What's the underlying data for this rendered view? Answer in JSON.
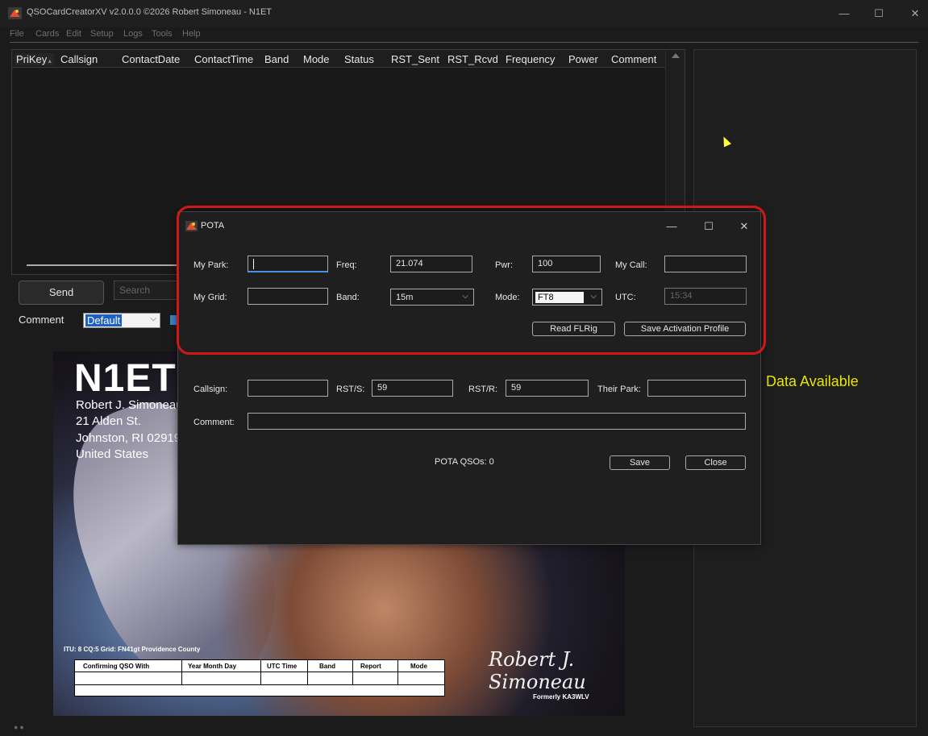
{
  "app": {
    "title": "QSOCardCreatorXV v2.0.0.0 ©2026 Robert Simoneau - N1ET",
    "icon": "app-logo-icon",
    "window_controls": {
      "minimize": "—",
      "maximize": "☐",
      "close": "✕"
    }
  },
  "menu": [
    "File",
    "Cards",
    "Edit",
    "Setup",
    "Logs",
    "Tools",
    "Help"
  ],
  "grid": {
    "columns": [
      "PriKey",
      "Callsign",
      "ContactDate",
      "ContactTime",
      "Band",
      "Mode",
      "Status",
      "RST_Sent",
      "RST_Rcvd",
      "Frequency",
      "Power",
      "Comment"
    ],
    "sorted_column": "PriKey",
    "sort_glyph": "▲"
  },
  "controls": {
    "send_label": "Send",
    "search_placeholder": "Search",
    "comment_label": "Comment",
    "comment_value": "Default"
  },
  "right_panel": {
    "message": "Data Available"
  },
  "card": {
    "callsign": "N1ET",
    "name": "Robert J. Simoneau",
    "street": "21 Alden St.",
    "city": "Johnston, RI 02919",
    "country": "United States",
    "location": "ITU: 8 CQ:5 Grid: FN41gt Providence County",
    "table_headers": [
      "Confirming QSO With",
      "Year Month Day",
      "UTC Time",
      "Band",
      "Report",
      "Mode"
    ],
    "signature": "Robert J. Simoneau",
    "formerly": "Formerly KA3WLV"
  },
  "pota": {
    "title": "POTA",
    "icon": "pota-logo-icon",
    "window_controls": {
      "minimize": "—",
      "maximize": "☐",
      "close": "✕"
    },
    "labels": {
      "my_park": "My Park:",
      "freq": "Freq:",
      "pwr": "Pwr:",
      "my_call": "My Call:",
      "my_grid": "My Grid:",
      "band": "Band:",
      "mode": "Mode:",
      "utc": "UTC:",
      "callsign": "Callsign:",
      "rst_s": "RST/S:",
      "rst_r": "RST/R:",
      "their_park": "Their Park:",
      "comment": "Comment:"
    },
    "values": {
      "my_park": "",
      "freq": "21.074",
      "pwr": "100",
      "my_call": "",
      "my_grid": "",
      "band": "15m",
      "mode": "FT8",
      "utc": "15:34",
      "callsign": "",
      "rst_s": "59",
      "rst_r": "59",
      "their_park": "",
      "comment": ""
    },
    "buttons": {
      "read_flrig": "Read FLRig",
      "save_profile": "Save Activation Profile",
      "save": "Save",
      "close": "Close"
    },
    "qso_count": "POTA QSOs: 0"
  }
}
